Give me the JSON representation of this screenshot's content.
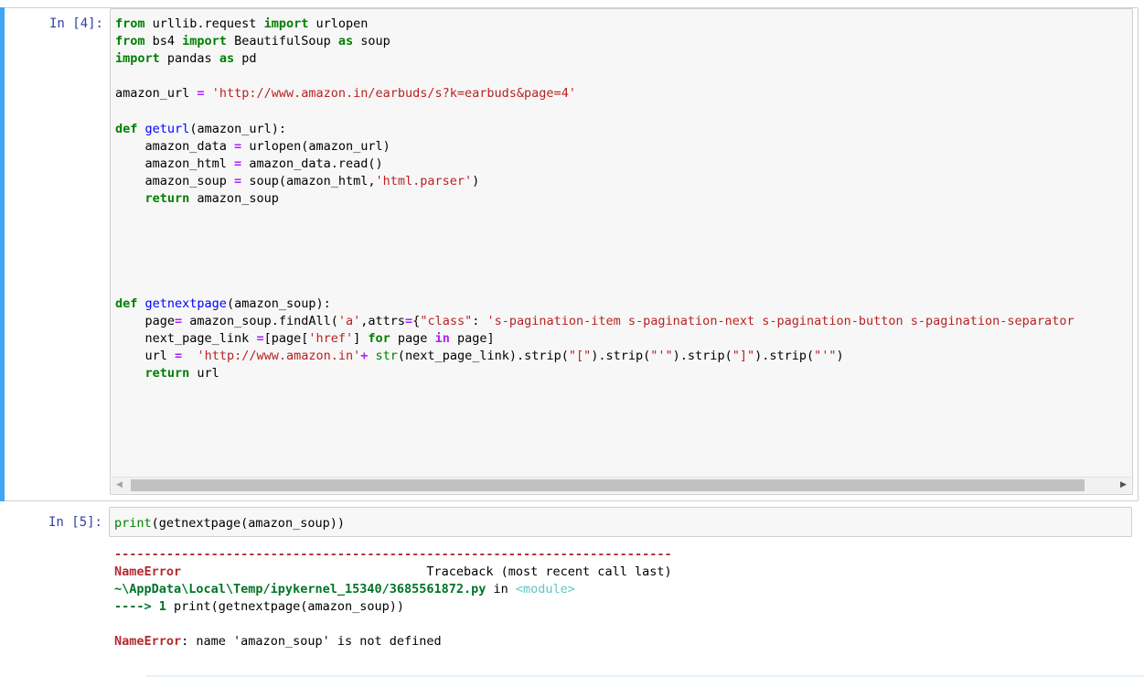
{
  "cells": [
    {
      "prompt": "In [4]:",
      "code_lines": [
        "from urllib.request import urlopen",
        "from bs4 import BeautifulSoup as soup",
        "import pandas as pd",
        "",
        "amazon_url = 'http://www.amazon.in/earbuds/s?k=earbuds&page=4'",
        "",
        "def geturl(amazon_url):",
        "    amazon_data = urlopen(amazon_url)",
        "    amazon_html = amazon_data.read()",
        "    amazon_soup = soup(amazon_html,'html.parser')",
        "    return amazon_soup",
        "",
        "",
        "",
        "",
        "",
        "def getnextpage(amazon_soup):",
        "    page= amazon_soup.findAll('a',attrs={\"class\": 's-pagination-item s-pagination-next s-pagination-button s-pagination-separator",
        "    next_page_link =[page['href'] for page in page]",
        "    url =  'http://www.amazon.in'+ str(next_page_link).strip(\"[\").strip(\"'\").strip(\"]\").strip(\"'\")",
        "    return url"
      ],
      "scroll_left_arrow": "◀",
      "scroll_right_arrow": "▶"
    },
    {
      "prompt": "In [5]:",
      "code": "print(getnextpage(amazon_soup))",
      "output": {
        "divider": "---------------------------------------------------------------------------",
        "error_name": "NameError",
        "traceback_label": "Traceback (most recent call last)",
        "file_path": "~\\AppData\\Local\\Temp/ipykernel_15340/3685561872.py",
        "in_word": " in ",
        "module": "<module>",
        "arrow_line_prefix": "----> 1 ",
        "arrow_line_code": "print(getnextpage(amazon_soup))",
        "error_type": "NameError",
        "error_message": ": name 'amazon_soup' is not defined"
      }
    }
  ],
  "colors": {
    "selected_border": "#42a5f5",
    "prompt": "#303f9f",
    "keyword": "#008000",
    "string": "#ba2121",
    "error": "#b22b31"
  }
}
